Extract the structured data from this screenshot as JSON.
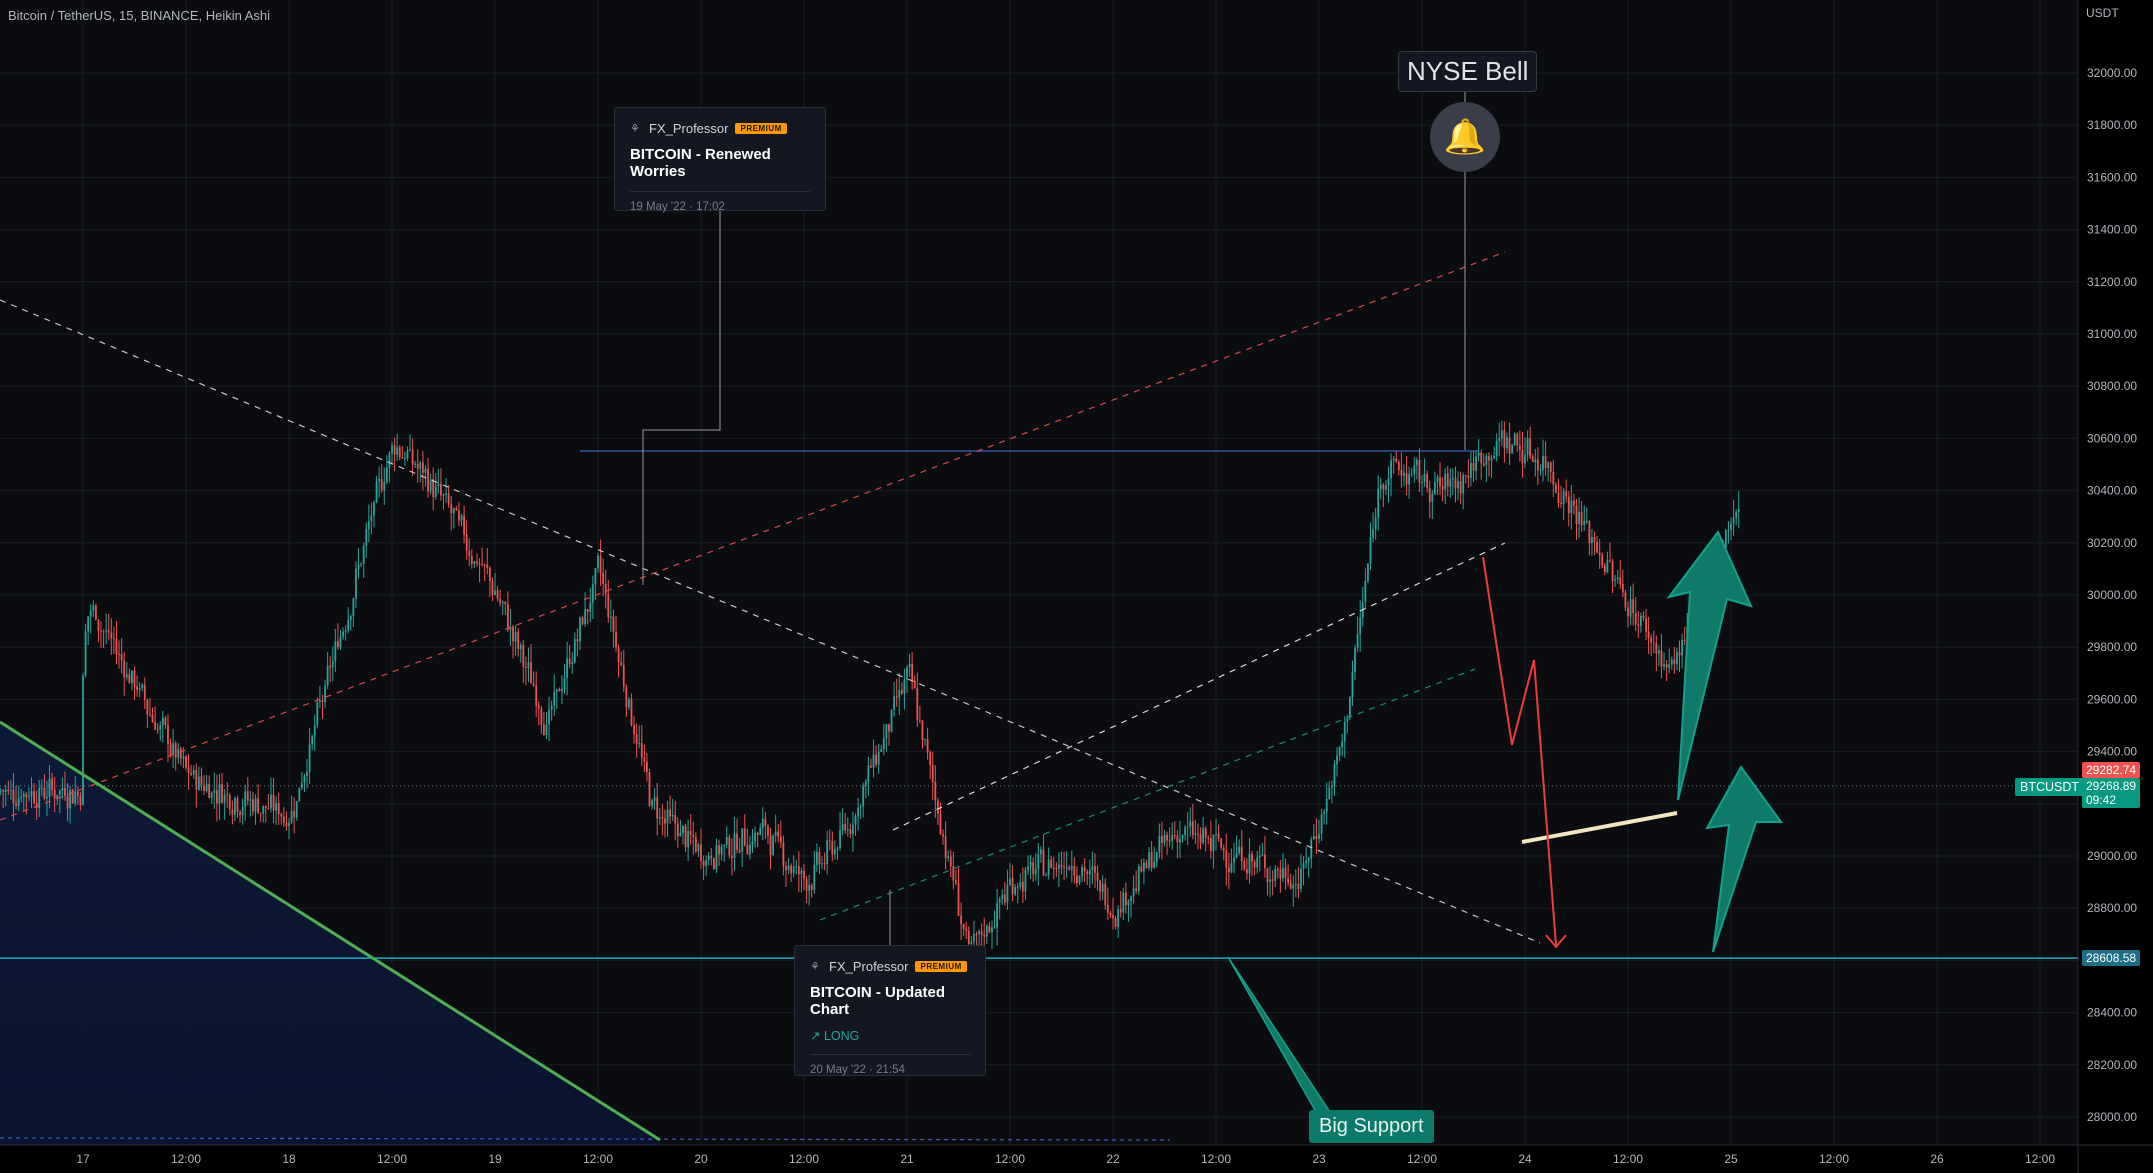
{
  "header": {
    "title": "Bitcoin / TetherUS, 15, BINANCE, Heikin Ashi",
    "currency": "USDT"
  },
  "colors": {
    "background": "#000000",
    "bull": "#26a69a",
    "bear": "#ef5350",
    "grid": "#1a1d26",
    "axis_text": "#b2b5be",
    "support_line": "#26a8c8",
    "green_trend": "#4caf50",
    "resistance": "#3a5fc0",
    "accent_orange": "#ff9800",
    "arrow_teal": "#0f7a6a"
  },
  "chart_data": {
    "type": "candlestick",
    "title": "Bitcoin / TetherUS, 15, BINANCE, Heikin Ashi",
    "y_axis": {
      "ticks": [
        28000,
        28200,
        28400,
        28600,
        28800,
        29000,
        29200,
        29400,
        29600,
        29800,
        30000,
        30200,
        30400,
        30600,
        30800,
        31000,
        31200,
        31400,
        31600,
        31800,
        32000
      ],
      "tick_labels": [
        "28000.00",
        "28200.00",
        "28400.00",
        "28600.00",
        "28800.00",
        "29000.00",
        "29200.00",
        "29400.00",
        "29600.00",
        "29800.00",
        "30000.00",
        "30200.00",
        "30400.00",
        "30600.00",
        "30800.00",
        "31000.00",
        "31200.00",
        "31400.00",
        "31600.00",
        "31800.00",
        "32000.00"
      ],
      "ylim": [
        27900,
        32200
      ],
      "unit": "USDT"
    },
    "x_axis": {
      "tick_labels": [
        "17",
        "12:00",
        "18",
        "12:00",
        "19",
        "12:00",
        "20",
        "12:00",
        "21",
        "12:00",
        "22",
        "12:00",
        "23",
        "12:00",
        "24",
        "12:00",
        "25",
        "12:00",
        "26",
        "12:00"
      ],
      "day_labels": [
        "17",
        "18",
        "19",
        "20",
        "21",
        "22",
        "23",
        "24",
        "25",
        "26"
      ]
    },
    "grid": true,
    "price_path": [
      [
        0,
        30000
      ],
      [
        0.5,
        29300
      ],
      [
        1,
        29150
      ],
      [
        1.5,
        30600
      ],
      [
        1.75,
        30350
      ],
      [
        2,
        30000
      ],
      [
        2.25,
        29500
      ],
      [
        2.5,
        30100
      ],
      [
        2.75,
        29200
      ],
      [
        3.0,
        29000
      ],
      [
        3.3,
        29100
      ],
      [
        3.5,
        28900
      ],
      [
        3.7,
        29100
      ],
      [
        4.0,
        29700
      ],
      [
        4.3,
        28600
      ],
      [
        4.5,
        28900
      ],
      [
        4.8,
        29000
      ],
      [
        5.0,
        28800
      ],
      [
        5.3,
        29100
      ],
      [
        5.6,
        29000
      ],
      [
        5.9,
        28900
      ],
      [
        6.1,
        29400
      ],
      [
        6.3,
        30500
      ],
      [
        6.6,
        30400
      ],
      [
        6.9,
        30600
      ],
      [
        7.1,
        30500
      ],
      [
        7.4,
        30100
      ],
      [
        7.7,
        29700
      ],
      [
        8.0,
        30300
      ],
      [
        8.3,
        30400
      ],
      [
        8.5,
        30100
      ],
      [
        8.8,
        29700
      ],
      [
        9.0,
        28900
      ],
      [
        9.3,
        29100
      ],
      [
        9.6,
        29200
      ],
      [
        10.0,
        29300
      ],
      [
        10.3,
        29500
      ],
      [
        10.6,
        29400
      ],
      [
        10.9,
        29300
      ],
      [
        11.2,
        29400
      ],
      [
        11.5,
        29500
      ],
      [
        11.8,
        29300
      ],
      [
        12.2,
        29500
      ],
      [
        12.4,
        30200
      ],
      [
        12.7,
        30000
      ],
      [
        13.0,
        29800
      ],
      [
        13.3,
        30100
      ],
      [
        13.6,
        30000
      ],
      [
        13.9,
        30300
      ],
      [
        14.2,
        30400
      ],
      [
        14.5,
        30200
      ],
      [
        14.8,
        30500
      ],
      [
        15.0,
        30400
      ],
      [
        15.3,
        30500
      ],
      [
        15.5,
        30100
      ],
      [
        15.8,
        29700
      ],
      [
        16.0,
        29300
      ],
      [
        16.2,
        29100
      ],
      [
        16.5,
        29300
      ],
      [
        16.8,
        29400
      ],
      [
        17.0,
        29250
      ]
    ],
    "last_price": "29268.89",
    "last_price_high": "29282.74",
    "countdown": "09:42",
    "support_level": "28608.58",
    "symbol": "BTCUSDT"
  },
  "annotations": {
    "nyse_label": "NYSE Bell",
    "big_support_label": "Big Support",
    "publication_1": {
      "author": "FX_Professor",
      "badge": "PREMIUM",
      "title": "BITCOIN - Renewed Worries",
      "date": "19 May '22 · 17:02"
    },
    "publication_2": {
      "author": "FX_Professor",
      "badge": "PREMIUM",
      "title": "BITCOIN - Updated Chart",
      "direction": "↗ LONG",
      "date": "20 May '22 · 21:54"
    }
  }
}
